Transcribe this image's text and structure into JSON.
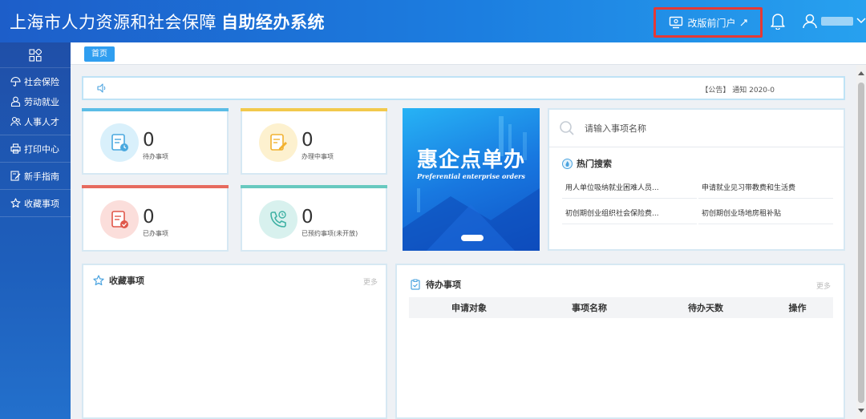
{
  "header": {
    "title_part1": "上海市人力资源和社会保障",
    "title_part2": "自助经办系统",
    "portal_label": "改版前门户"
  },
  "sidebar": {
    "items": [
      {
        "label": "社会保险",
        "icon": "umbrella-icon"
      },
      {
        "label": "劳动就业",
        "icon": "worker-icon"
      },
      {
        "label": "人事人才",
        "icon": "people-icon"
      },
      {
        "label": "打印中心",
        "icon": "printer-icon"
      },
      {
        "label": "新手指南",
        "icon": "guide-icon"
      },
      {
        "label": "收藏事项",
        "icon": "star-icon"
      }
    ]
  },
  "tabs": [
    {
      "label": "首页"
    }
  ],
  "notice": {
    "text": "【公告】 通知 2020-0"
  },
  "stats": [
    {
      "value": "0",
      "label": "待办事项",
      "color": "#5bbde6"
    },
    {
      "value": "0",
      "label": "办理中事项",
      "color": "#f2c94c"
    },
    {
      "value": "0",
      "label": "已办事项",
      "color": "#e66a5e"
    },
    {
      "value": "0",
      "label": "已预约事项(未开放)",
      "color": "#67c9bf"
    }
  ],
  "banner": {
    "title": "惠企点单办",
    "subtitle": "Preferential enterprise orders"
  },
  "search": {
    "placeholder": "请输入事项名称",
    "hot_title": "热门搜索",
    "hot_items": [
      "用人单位吸纳就业困难人员...",
      "申请就业见习带教费和生活费",
      "初创期创业组织社会保险费...",
      "初创期创业场地房租补贴"
    ]
  },
  "favorites": {
    "title": "收藏事项",
    "more": "更多"
  },
  "todo": {
    "title": "待办事项",
    "more": "更多",
    "columns": [
      "申请对象",
      "事项名称",
      "待办天数",
      "操作"
    ]
  }
}
